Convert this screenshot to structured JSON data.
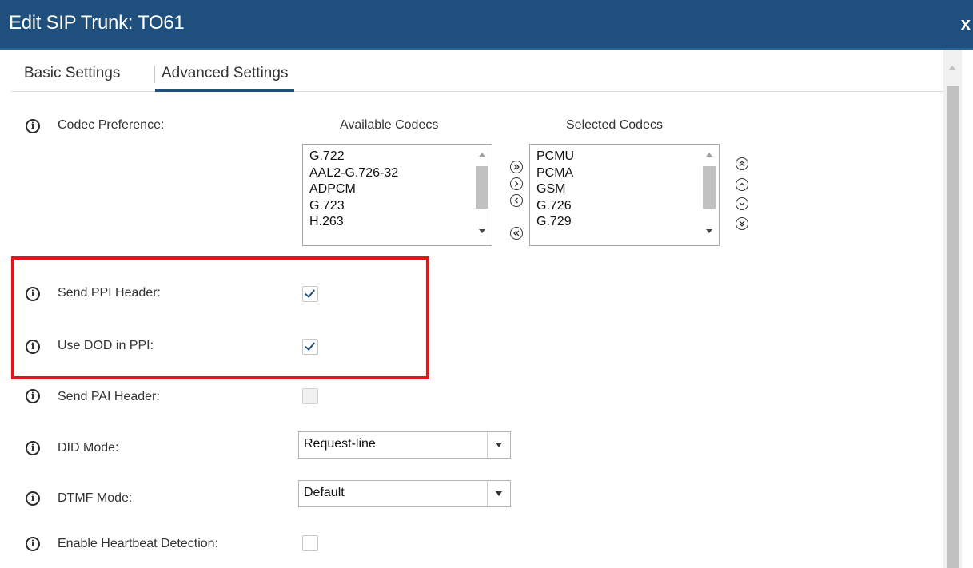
{
  "dialog": {
    "title": "Edit SIP Trunk: TO61",
    "close_label": "x"
  },
  "tabs": [
    {
      "label": "Basic Settings",
      "active": false
    },
    {
      "label": "Advanced Settings",
      "active": true
    }
  ],
  "codec": {
    "label": "Codec Preference:",
    "available_header": "Available Codecs",
    "selected_header": "Selected Codecs",
    "available": [
      "G.722",
      "AAL2-G.726-32",
      "ADPCM",
      "G.723",
      "H.263"
    ],
    "selected": [
      "PCMU",
      "PCMA",
      "GSM",
      "G.726",
      "G.729"
    ],
    "transfer_buttons": [
      "move-all-right-icon",
      "move-right-icon",
      "move-left-icon",
      "move-all-left-icon"
    ],
    "order_buttons": [
      "move-top-icon",
      "move-up-icon",
      "move-down-icon",
      "move-bottom-icon"
    ]
  },
  "settings": {
    "send_ppi_header": {
      "label": "Send PPI Header:",
      "checked": true
    },
    "use_dod_in_ppi": {
      "label": "Use DOD in PPI:",
      "checked": true
    },
    "send_pai_header": {
      "label": "Send PAI Header:",
      "checked": false,
      "disabled": true
    },
    "did_mode": {
      "label": "DID Mode:",
      "value": "Request-line"
    },
    "dtmf_mode": {
      "label": "DTMF Mode:",
      "value": "Default"
    },
    "heartbeat": {
      "label": "Enable Heartbeat Detection:",
      "checked": false
    }
  },
  "icons": {
    "info": "info-icon",
    "info_glyph": "i"
  },
  "colors": {
    "titlebar": "#1f4f7c",
    "highlight": "#e5141b",
    "check": "#1f4f7c"
  }
}
